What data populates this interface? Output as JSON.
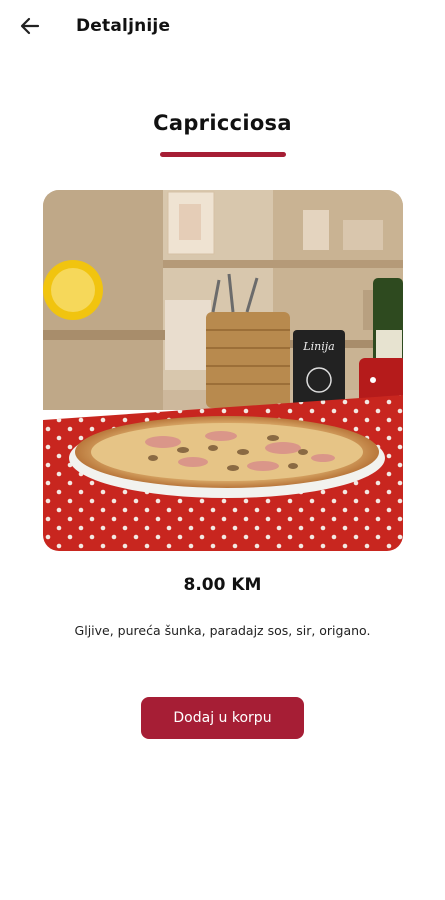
{
  "appbar": {
    "title": "Detaljnije",
    "back_icon": "arrow-left-icon"
  },
  "product": {
    "name": "Capricciosa",
    "price": "8.00 KM",
    "description": "Gljive, pureća šunka, paradajz sos, sir, origano.",
    "image_alt": "Capricciosa pizza",
    "image_sign_text": "Linija"
  },
  "actions": {
    "add_to_cart_label": "Dodaj u korpu"
  },
  "colors": {
    "accent": "#a61e35",
    "text": "#111111",
    "background": "#ffffff"
  }
}
